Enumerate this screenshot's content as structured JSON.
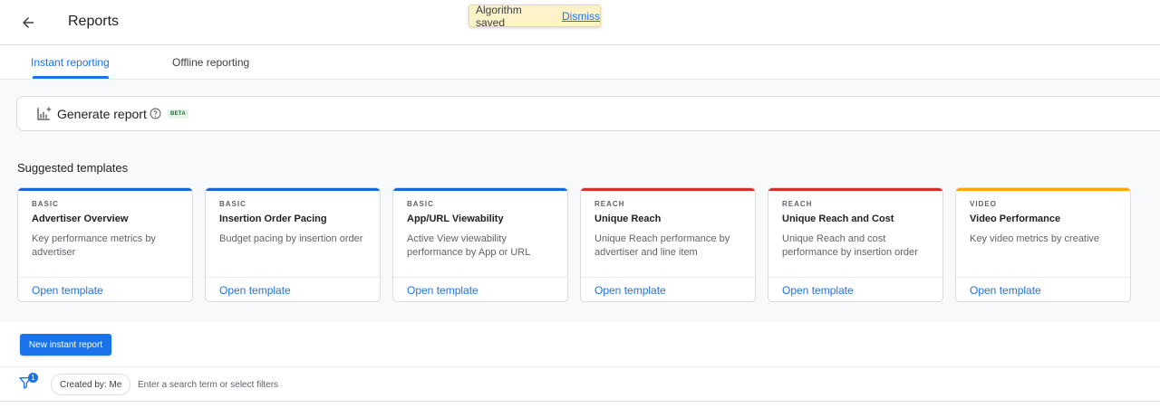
{
  "header": {
    "title": "Reports"
  },
  "toast": {
    "message": "Algorithm saved",
    "action": "Dismiss"
  },
  "tabs": [
    {
      "label": "Instant reporting",
      "active": true
    },
    {
      "label": "Offline reporting",
      "active": false
    }
  ],
  "generate": {
    "title": "Generate report",
    "badge": "BETA"
  },
  "suggested": {
    "title": "Suggested templates",
    "cards": [
      {
        "category": "BASIC",
        "name": "Advertiser Overview",
        "description": "Key performance metrics by advertiser",
        "action": "Open template",
        "color": "#1967d2"
      },
      {
        "category": "BASIC",
        "name": "Insertion Order Pacing",
        "description": "Budget pacing by insertion order",
        "action": "Open template",
        "color": "#1967d2"
      },
      {
        "category": "BASIC",
        "name": "App/URL Viewability",
        "description": "Active View viewability performance by App or URL",
        "action": "Open template",
        "color": "#1967d2"
      },
      {
        "category": "REACH",
        "name": "Unique Reach",
        "description": "Unique Reach performance by advertiser and line item",
        "action": "Open template",
        "color": "#d93025"
      },
      {
        "category": "REACH",
        "name": "Unique Reach and Cost",
        "description": "Unique Reach and cost performance by insertion order",
        "action": "Open template",
        "color": "#d93025"
      },
      {
        "category": "VIDEO",
        "name": "Video Performance",
        "description": "Key video metrics by creative",
        "action": "Open template",
        "color": "#f9ab00"
      }
    ]
  },
  "new_report_button": "New instant report",
  "filters": {
    "badge_count": "1",
    "chip": "Created by: Me",
    "placeholder": "Enter a search term or select filters"
  },
  "colors": {
    "accent": "#1a73e8",
    "toast_bg": "#fdf3c8"
  }
}
